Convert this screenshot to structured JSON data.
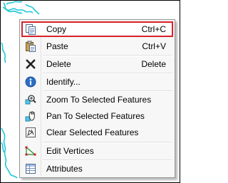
{
  "menu": {
    "items": [
      {
        "label": "Copy",
        "shortcut": "Ctrl+C",
        "icon": "copy-icon"
      },
      {
        "label": "Paste",
        "shortcut": "Ctrl+V",
        "icon": "paste-icon"
      },
      {
        "label": "Delete",
        "shortcut": "Delete",
        "icon": "delete-x-icon"
      },
      {
        "label": "Identify...",
        "icon": "identify-info-icon"
      },
      {
        "label": "Zoom To Selected Features",
        "icon": "zoom-to-selected-icon"
      },
      {
        "label": "Pan To Selected Features",
        "icon": "pan-to-selected-icon"
      },
      {
        "label": "Clear Selected Features",
        "icon": "clear-selection-icon"
      },
      {
        "label": "Edit Vertices",
        "icon": "edit-vertices-icon"
      },
      {
        "label": "Attributes",
        "icon": "attributes-table-icon"
      }
    ]
  },
  "colors": {
    "highlight_border": "#d9202a",
    "map_feature": "#1fc8d6",
    "menu_background": "#f7f7f7"
  }
}
